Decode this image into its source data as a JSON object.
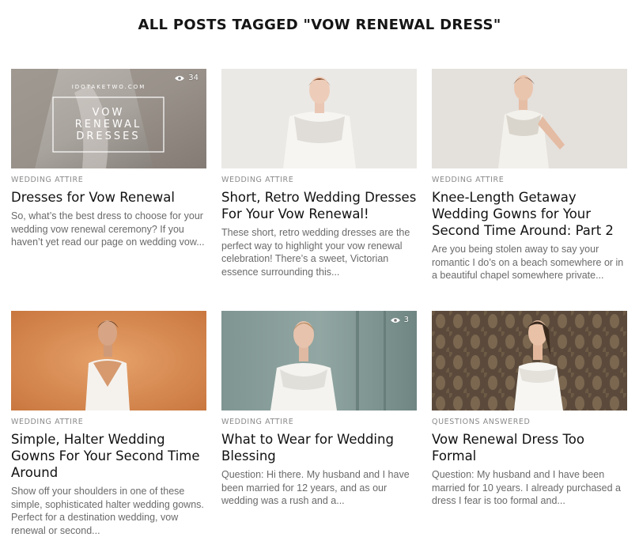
{
  "page": {
    "title": "ALL POSTS TAGGED \"VOW RENEWAL DRESS\""
  },
  "posts": [
    {
      "category": "WEDDING ATTIRE",
      "title": "Dresses for Vow Renewal",
      "excerpt": "So, what’s the best dress to choose for your wedding vow renewal ceremony? If you haven’t yet read our page on wedding vow...",
      "views": "34",
      "thumbnail": {
        "site": "IDOTAKETWO.COM",
        "line1": "VOW",
        "line2": "RENEWAL",
        "line3": "DRESSES"
      }
    },
    {
      "category": "WEDDING ATTIRE",
      "title": "Short, Retro Wedding Dresses For Your Vow Renewal!",
      "excerpt": "These short, retro wedding dresses are the perfect way to highlight your vow renewal celebration! There’s a sweet, Victorian essence surrounding this..."
    },
    {
      "category": "WEDDING ATTIRE",
      "title": "Knee-Length Getaway Wedding Gowns for Your Second Time Around: Part 2",
      "excerpt": "Are you being stolen away to say your romantic I do’s on a beach somewhere or in a beautiful chapel somewhere private..."
    },
    {
      "category": "WEDDING ATTIRE",
      "title": "Simple, Halter Wedding Gowns For Your Second Time Around",
      "excerpt": "Show off your shoulders in one of these simple, sophisticated halter wedding gowns. Perfect for a destination wedding, vow renewal or second..."
    },
    {
      "category": "WEDDING ATTIRE",
      "title": "What to Wear for Wedding Blessing",
      "excerpt": "Question: Hi there. My husband and I have been married for 12 years, and as our wedding was a rush and a...",
      "views": "3"
    },
    {
      "category": "QUESTIONS ANSWERED",
      "title": "Vow Renewal Dress Too Formal",
      "excerpt": "Question: My husband and I have been married for 10 years. I already purchased a dress I fear is too formal and..."
    }
  ]
}
